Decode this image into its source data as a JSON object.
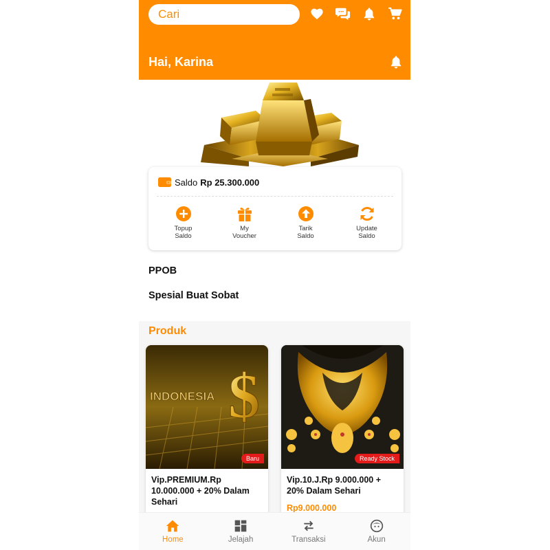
{
  "colors": {
    "primary": "#ff8c00",
    "badge": "#e31b1b",
    "text": "#111111"
  },
  "header": {
    "search_placeholder": "Cari",
    "icons": [
      "heart-icon",
      "chat-icon",
      "bell-icon",
      "cart-icon"
    ],
    "greeting": "Hai, Karina"
  },
  "saldo": {
    "label": "Saldo",
    "amount": "Rp 25.300.000",
    "actions": [
      {
        "label": "Topup\nSaldo",
        "icon": "plus-circle-icon"
      },
      {
        "label": "My\nVoucher",
        "icon": "gift-icon"
      },
      {
        "label": "Tarik\nSaldo",
        "icon": "arrow-up-circle-icon"
      },
      {
        "label": "Update\nSaldo",
        "icon": "refresh-icon"
      }
    ]
  },
  "sections": {
    "ppob": "PPOB",
    "spesial": "Spesial Buat Sobat",
    "produk": "Produk"
  },
  "products": [
    {
      "name": "Vip.PREMIUM.Rp 10.000.000 + 20% Dalam Sehari",
      "badge": "Baru",
      "image_text": "INDONESIA",
      "price": ""
    },
    {
      "name": "Vip.10.J.Rp 9.000.000 + 20% Dalam Sehari",
      "badge": "Ready Stock",
      "price": "Rp9.000.000"
    }
  ],
  "bottom_nav": [
    {
      "label": "Home",
      "icon": "home-icon",
      "active": true
    },
    {
      "label": "Jelajah",
      "icon": "grid-icon",
      "active": false
    },
    {
      "label": "Transaksi",
      "icon": "swap-icon",
      "active": false
    },
    {
      "label": "Akun",
      "icon": "face-icon",
      "active": false
    }
  ]
}
